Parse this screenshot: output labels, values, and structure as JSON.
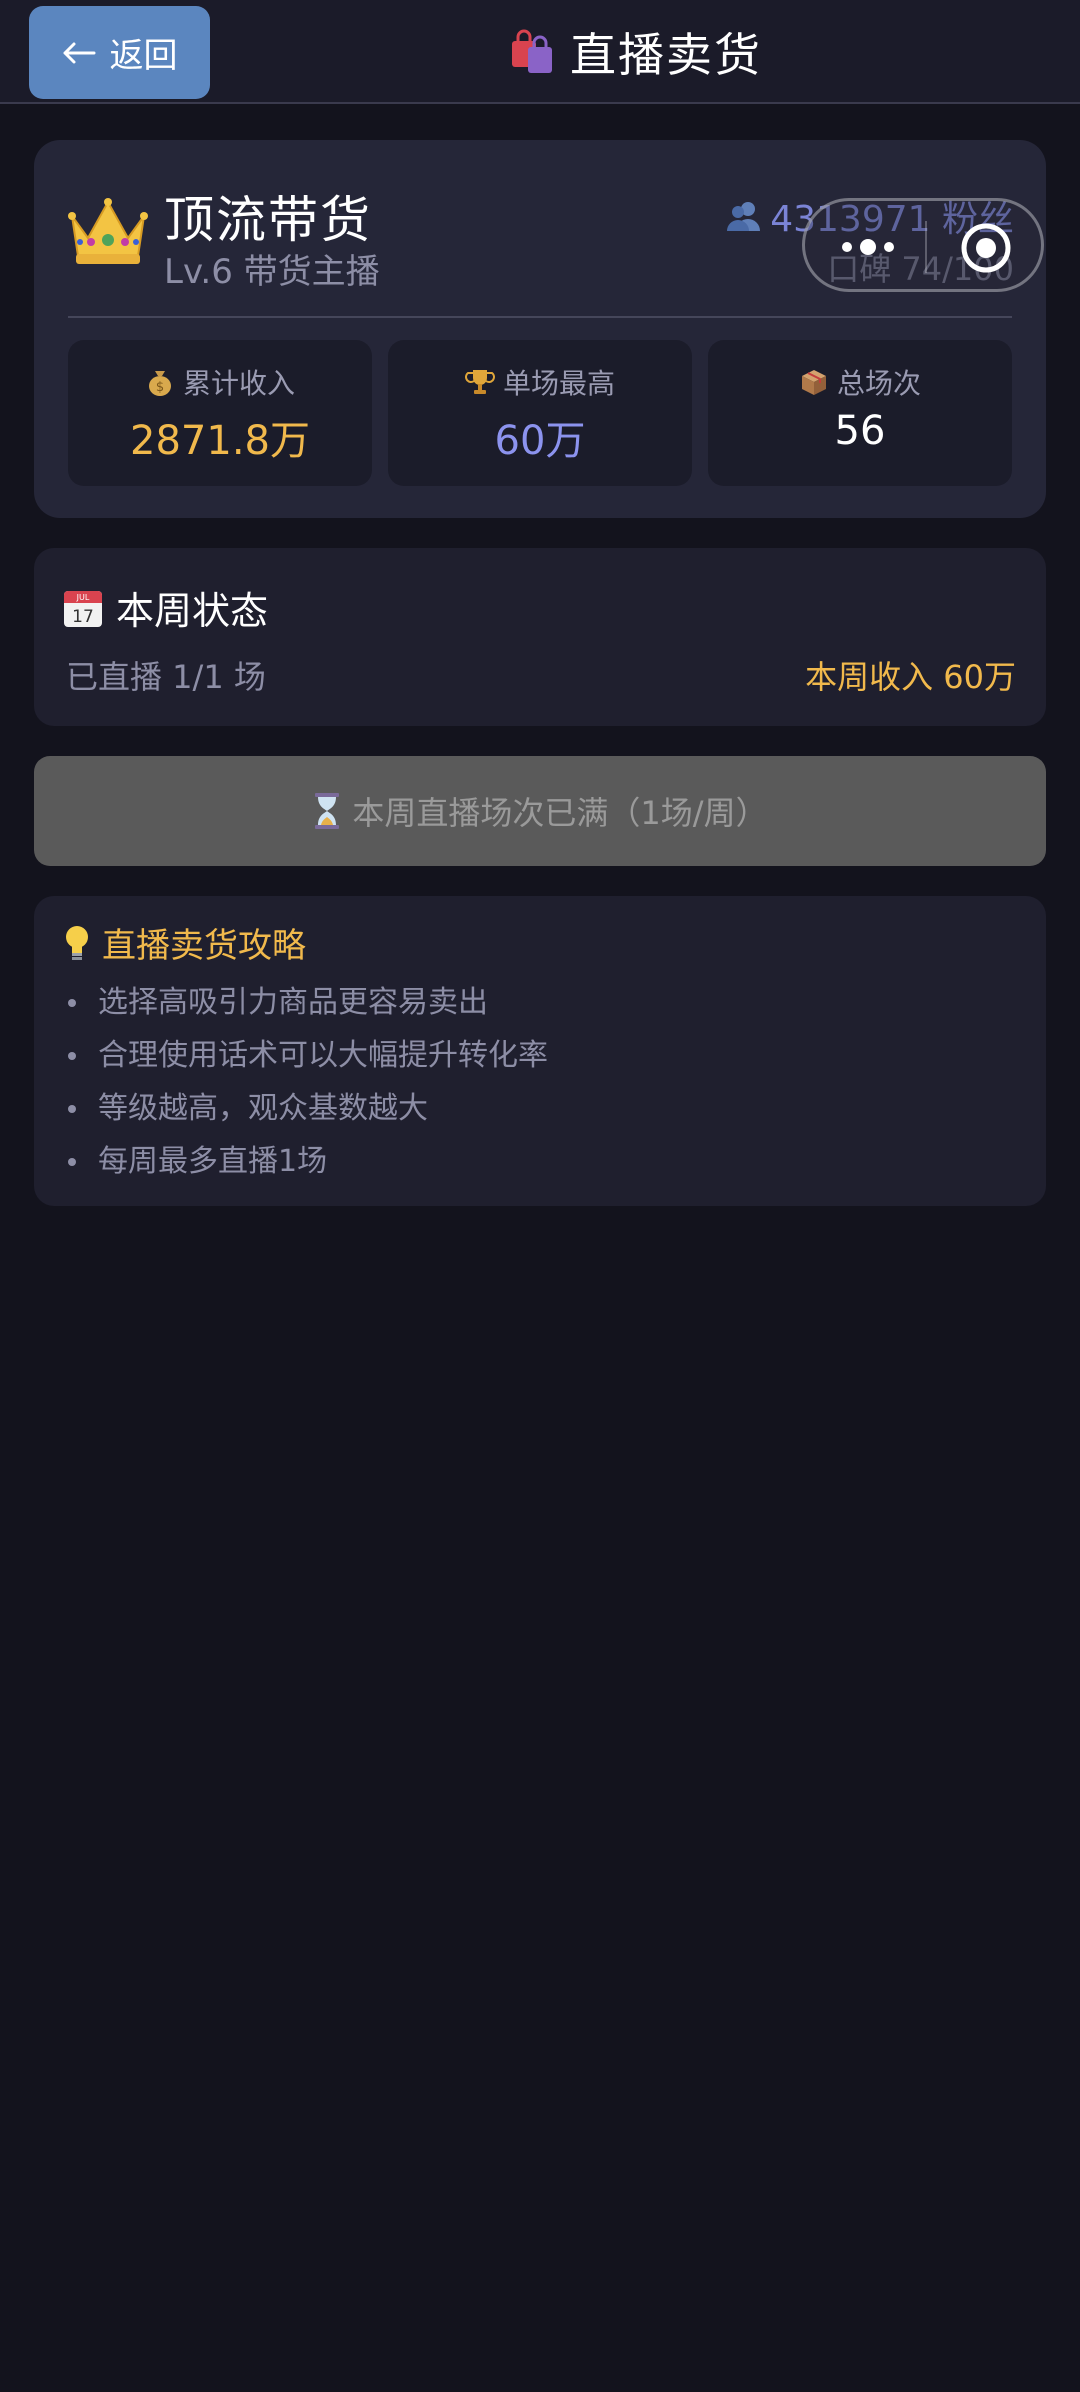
{
  "header": {
    "back_label": "返回",
    "title": "直播卖货"
  },
  "profile": {
    "name": "顶流带货",
    "level": "Lv.6 带货主播",
    "fans": "4313971 粉丝",
    "reputation": "口碑 74/100"
  },
  "stats": [
    {
      "icon": "money-bag-icon",
      "label": "累计收入",
      "value": "2871.8万",
      "color": "#f1b94c"
    },
    {
      "icon": "trophy-icon",
      "label": "单场最高",
      "value": "60万",
      "color": "#8c93ee"
    },
    {
      "icon": "package-icon",
      "label": "总场次",
      "value": "56",
      "color": "#ffffff"
    }
  ],
  "week": {
    "title": "本周状态",
    "progress": "已直播 1/1 场",
    "income": "本周收入 60万"
  },
  "action": {
    "label": "本周直播场次已满（1场/周）"
  },
  "tips": {
    "title": "直播卖货攻略",
    "items": [
      "选择高吸引力商品更容易卖出",
      "合理使用话术可以大幅提升转化率",
      "等级越高，观众基数越大",
      "每周最多直播1场"
    ]
  },
  "colors": {
    "background": "#13131d",
    "accent_gold": "#f1b94c",
    "accent_purple": "#8c93ee",
    "back_button": "#5b86bf"
  }
}
